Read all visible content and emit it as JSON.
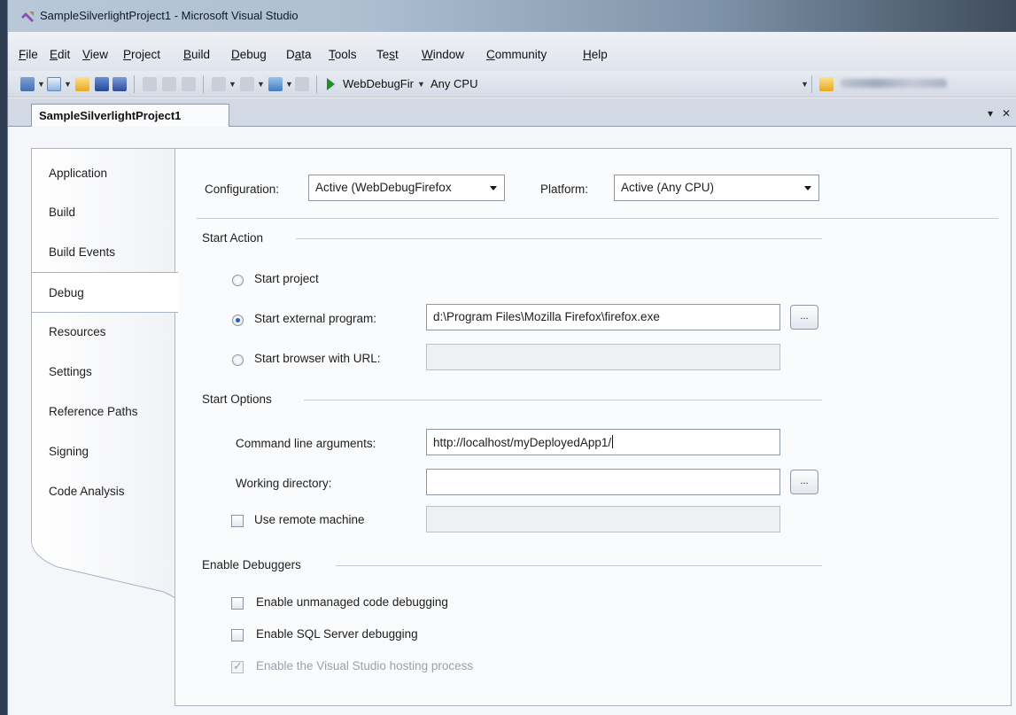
{
  "window": {
    "title": "SampleSilverlightProject1 - Microsoft Visual Studio"
  },
  "menu": {
    "file": {
      "u": "F",
      "rest": "ile"
    },
    "edit": {
      "u": "E",
      "rest": "dit"
    },
    "view": {
      "u": "V",
      "rest": "iew"
    },
    "project": {
      "u": "P",
      "rest": "roject"
    },
    "build": {
      "u": "B",
      "rest": "uild"
    },
    "debug": {
      "u": "D",
      "rest": "ebug"
    },
    "data": {
      "pre": "D",
      "u": "a",
      "rest": "ta"
    },
    "tools": {
      "u": "T",
      "rest": "ools"
    },
    "test": {
      "pre": "Te",
      "u": "s",
      "rest": "t"
    },
    "window": {
      "u": "W",
      "rest": "indow"
    },
    "community": {
      "u": "C",
      "rest": "ommunity"
    },
    "help": {
      "u": "H",
      "rest": "elp"
    }
  },
  "toolbar": {
    "solution_config": "WebDebugFir",
    "solution_platform": "Any CPU"
  },
  "document_tab": {
    "label": "SampleSilverlightProject1",
    "dropdown_glyph": "▾",
    "close_glyph": "✕"
  },
  "side_tabs": [
    "Application",
    "Build",
    "Build Events",
    "Debug",
    "Resources",
    "Settings",
    "Reference Paths",
    "Signing",
    "Code Analysis"
  ],
  "debug_page": {
    "configuration_label": "Configuration:",
    "configuration_value": "Active (WebDebugFirefox",
    "platform_label": "Platform:",
    "platform_value": "Active (Any CPU)",
    "start_action": {
      "heading": "Start Action",
      "start_project": "Start project",
      "start_external": "Start external program:",
      "external_path": "d:\\Program Files\\Mozilla Firefox\\firefox.exe",
      "start_browser": "Start browser with URL:",
      "browser_url": "",
      "selected": "start_external"
    },
    "start_options": {
      "heading": "Start Options",
      "cmd_args_label": "Command line arguments:",
      "cmd_args_value": "http://localhost/myDeployedApp1/",
      "working_dir_label": "Working directory:",
      "working_dir_value": "",
      "remote_label": "Use remote machine",
      "remote_value": ""
    },
    "debuggers": {
      "heading": "Enable Debuggers",
      "unmanaged": "Enable unmanaged code debugging",
      "sql": "Enable SQL Server debugging",
      "hosting": "Enable the Visual Studio hosting process"
    },
    "browse_label": "..."
  },
  "colors": {
    "accent": "#2a5fb0",
    "panel_border": "#a9b3c2",
    "disabled_text": "#9aa1ab"
  }
}
